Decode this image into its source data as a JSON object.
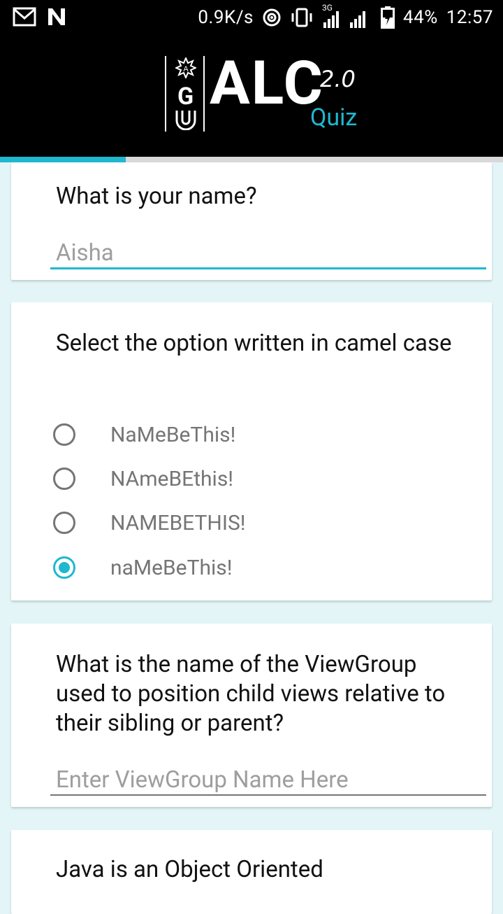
{
  "status_bar": {
    "net_speed": "0.9K/s",
    "network": "3G",
    "battery": "44%",
    "time": "12:57"
  },
  "header": {
    "logo_org": "AGU",
    "logo_org_letter": "G",
    "logo_title": "ALC",
    "logo_version": "2.0",
    "logo_subtitle": "Quiz"
  },
  "progress": {
    "value": 0.25,
    "color": "#1fb8cf"
  },
  "questions": [
    {
      "text": "What is your name?",
      "answer": "Aisha"
    },
    {
      "text": "Select the option written in camel case",
      "options": [
        "NaMeBeThis!",
        "NAmeBEthis!",
        "NAMEBETHIS!",
        "naMeBeThis!"
      ],
      "selected_index": 3
    },
    {
      "text": "What is the name of the ViewGroup used to position child views relative to their sibling or parent?",
      "placeholder": "Enter ViewGroup Name Here"
    },
    {
      "text": "Java is an Object Oriented"
    }
  ],
  "colors": {
    "accent": "#1fb8cf",
    "background": "#e3f5f7"
  }
}
